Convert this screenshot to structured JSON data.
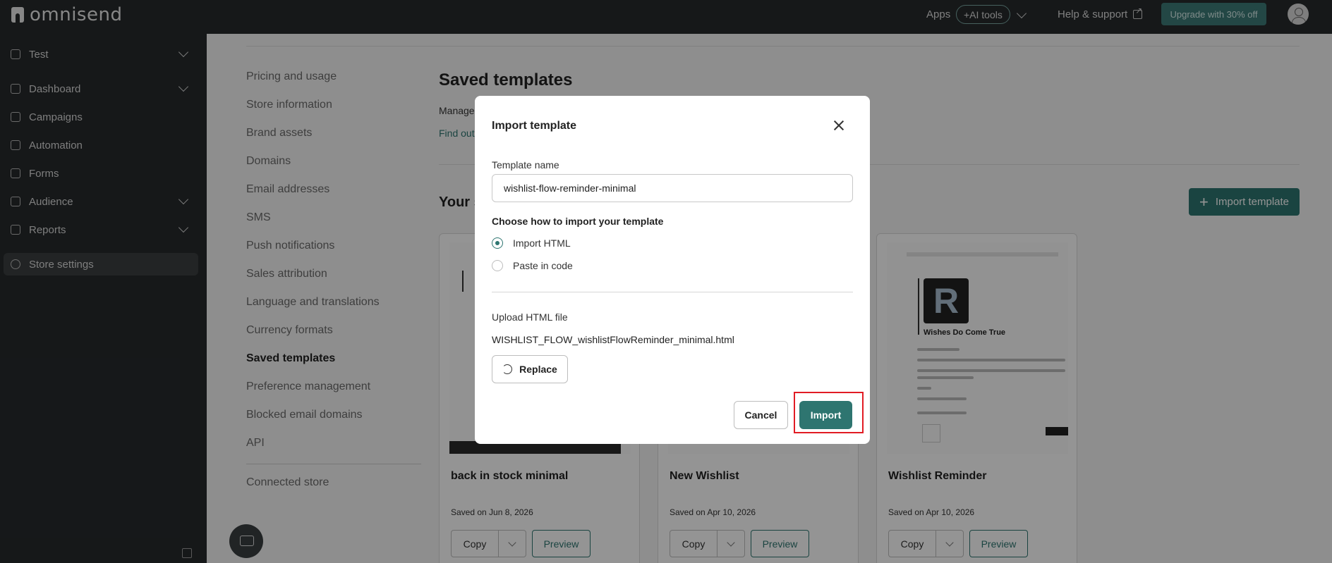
{
  "topbar": {
    "logo_text": "omnisend",
    "apps_label": "Apps",
    "ai_tools_label": "+AI tools",
    "help_label": "Help & support",
    "upgrade_label": "Upgrade with 30% off"
  },
  "sidebar": {
    "items": [
      {
        "label": "Test",
        "icon": "store-icon",
        "chevron": true
      },
      {
        "label": "Dashboard",
        "icon": "grid-icon",
        "chevron": true
      },
      {
        "label": "Campaigns",
        "icon": "mail-icon",
        "chevron": false
      },
      {
        "label": "Automation",
        "icon": "flow-icon",
        "chevron": false
      },
      {
        "label": "Forms",
        "icon": "form-icon",
        "chevron": false
      },
      {
        "label": "Audience",
        "icon": "user-icon",
        "chevron": true
      },
      {
        "label": "Reports",
        "icon": "chart-icon",
        "chevron": true
      },
      {
        "label": "Store settings",
        "icon": "gear-icon",
        "chevron": false,
        "active": true
      }
    ]
  },
  "settings_nav": {
    "items": [
      "Pricing and usage",
      "Store information",
      "Brand assets",
      "Domains",
      "Email addresses",
      "SMS",
      "Push notifications",
      "Sales attribution",
      "Language and translations",
      "Currency formats",
      "Saved templates",
      "Preference management",
      "Blocked email domains",
      "API"
    ],
    "connected_store": "Connected store"
  },
  "page": {
    "title": "Saved templates",
    "manage_text": "Manage",
    "find_out_text": "Find out",
    "your_text": "Your s",
    "import_template_label": "Import template"
  },
  "cards": [
    {
      "name": "back in stock minimal",
      "date": "Saved on Jun 8, 2026",
      "copy": "Copy",
      "preview": "Preview"
    },
    {
      "name": "New Wishlist",
      "date": "Saved on Apr 10, 2026",
      "copy": "Copy",
      "preview": "Preview"
    },
    {
      "name": "Wishlist Reminder",
      "date": "Saved on Apr 10, 2026",
      "copy": "Copy",
      "preview": "Preview",
      "thumb_title": "Wishes Do Come True",
      "thumb_logo": "R"
    }
  ],
  "modal": {
    "title": "Import template",
    "template_name_label": "Template name",
    "template_name_value": "wishlist-flow-reminder-minimal",
    "choose_label": "Choose how to import your template",
    "option_html": "Import HTML",
    "option_paste": "Paste in code",
    "upload_label": "Upload HTML file",
    "file_name": "WISHLIST_FLOW_wishlistFlowReminder_minimal.html",
    "replace_label": "Replace",
    "cancel_label": "Cancel",
    "import_label": "Import"
  },
  "colors": {
    "accent": "#2e7570",
    "sidebar_bg": "#262a2c",
    "highlight": "#e11c24"
  }
}
